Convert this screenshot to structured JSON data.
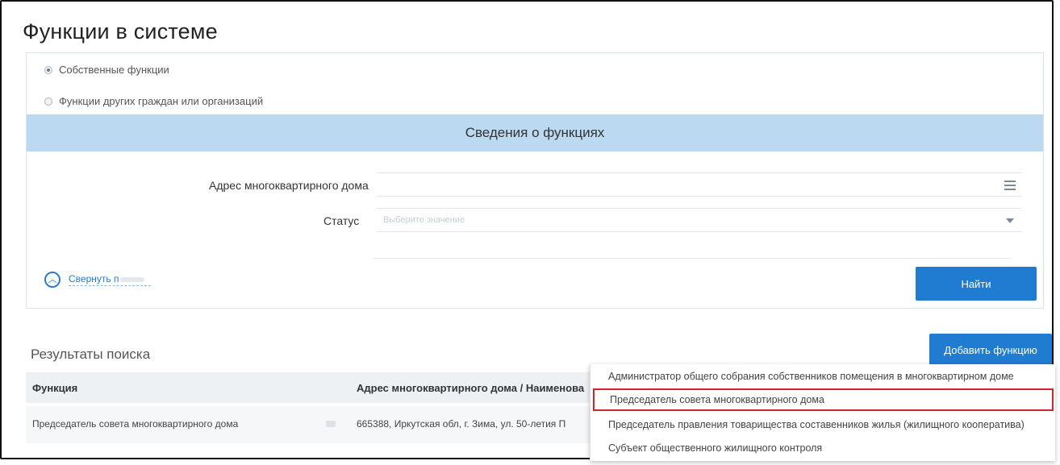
{
  "page": {
    "title": "Функции в системе"
  },
  "filters": {
    "radio_own": "Собственные функции",
    "radio_others": "Функции других граждан или организаций",
    "section_title": "Сведения о функциях",
    "address_label": "Адрес многоквартирного дома",
    "status_label": "Статус",
    "status_placeholder": "Выберите значение",
    "collapse_label": "Свернуть п",
    "search_button": "Найти"
  },
  "results": {
    "title": "Результаты поиска",
    "add_button": "Добавить функцию",
    "columns": [
      "Функция",
      "Адрес многоквартирного дома / Наименова"
    ],
    "rows": [
      {
        "function": "Председатель совета многоквартирного дома",
        "address": "665388, Иркутская обл, г. Зима, ул. 50-летия П"
      }
    ]
  },
  "dropdown": {
    "items": [
      "Администратор общего собрания собственников помещения в многоквартирном доме",
      "Председатель совета многоквартирного дома",
      "Председатель правления товарищества составенников жилья (жилищного кооператива)",
      "Субъект общественного жилищного контроля"
    ],
    "highlighted_index": 1
  },
  "colors": {
    "accent": "#1f7cd0",
    "section_header": "#bcd9f2",
    "highlight_border": "#d4232f"
  }
}
